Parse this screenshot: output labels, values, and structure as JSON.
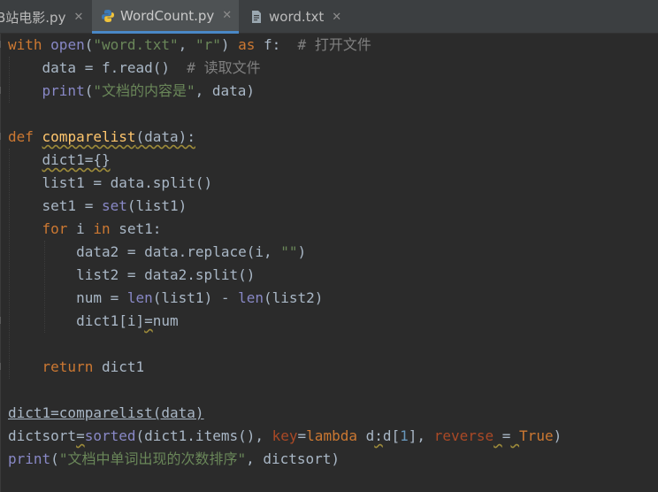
{
  "tabs": [
    {
      "label": "B站电影.py",
      "active": false,
      "icon": "python-file-icon"
    },
    {
      "label": "WordCount.py",
      "active": true,
      "icon": "python-file-icon"
    },
    {
      "label": "word.txt",
      "active": false,
      "icon": "text-file-icon"
    }
  ],
  "close_glyph": "✕",
  "code": {
    "l1": {
      "t1": "with",
      "t2": " ",
      "t3": "open",
      "t4": "(",
      "t5": "\"word.txt\"",
      "t6": ", ",
      "t7": "\"r\"",
      "t8": ") ",
      "t9": "as",
      "t10": " f:  ",
      "t11": "# 打开文件"
    },
    "l2": {
      "t1": "    data = f.read()  ",
      "t2": "# 读取文件"
    },
    "l3": {
      "t1": "    ",
      "t2": "print",
      "t3": "(",
      "t4": "\"文档的内容是\"",
      "t5": ", data)"
    },
    "l5": {
      "t1": "def",
      "t2": " ",
      "t3": "comparelist",
      "t4": "(data):"
    },
    "l6": {
      "t1": "    ",
      "t2": "dict1={}"
    },
    "l7": {
      "t1": "    list1 = data.split()"
    },
    "l8": {
      "t1": "    set1 = ",
      "t2": "set",
      "t3": "(list1)"
    },
    "l9": {
      "t1": "    ",
      "t2": "for",
      "t3": " i ",
      "t4": "in",
      "t5": " set1:"
    },
    "l10": {
      "t1": "        data2 = data.replace(i, ",
      "t2": "\"\"",
      "t3": ")"
    },
    "l11": {
      "t1": "        list2 = data2.split()"
    },
    "l12": {
      "t1": "        num = ",
      "t2": "len",
      "t3": "(list1) - ",
      "t4": "len",
      "t5": "(list2)"
    },
    "l13": {
      "t1": "        dict1[i]",
      "t2": "=",
      "t3": "num"
    },
    "l15": {
      "t1": "    ",
      "t2": "return",
      "t3": " dict1"
    },
    "l17": {
      "t1": "dict1=comparelist(data)"
    },
    "l18": {
      "t1": "dictsort",
      "t2": "=",
      "t3": "sorted",
      "t4": "(dict1.items(), ",
      "t5": "key",
      "t6": "=",
      "t7": "lambda",
      "t8": " d",
      "t9": ":",
      "t10": "d[",
      "t11": "1",
      "t12": "], ",
      "t13": "reverse",
      "t14": " ",
      "t15": "=",
      "t16": " ",
      "t17": "True",
      "t18": ")"
    },
    "l19": {
      "t1": "print",
      "t2": "(",
      "t3": "\"文档中单词出现的次数排序\"",
      "t4": ", dictsort)"
    }
  }
}
